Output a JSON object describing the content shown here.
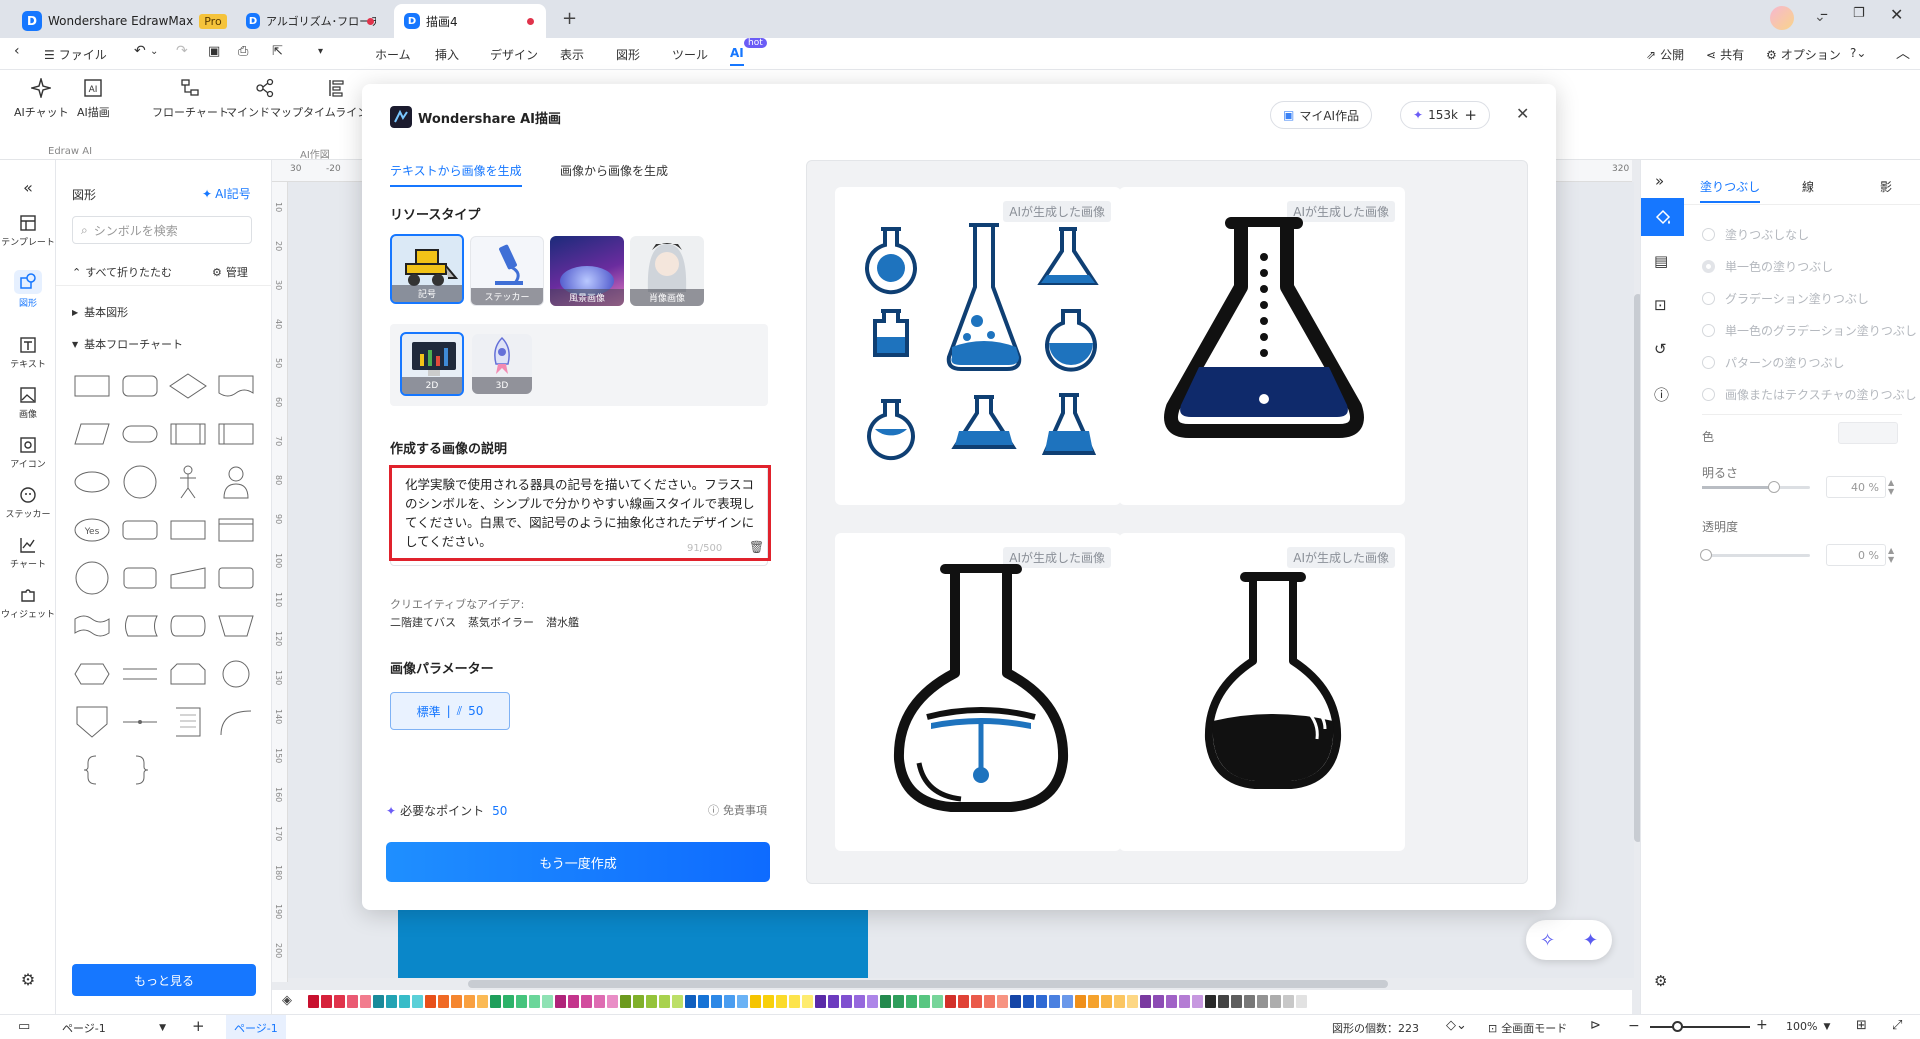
{
  "titlebar": {
    "app_tab": "Wondershare EdrawMax",
    "pro_badge": "Pro",
    "doc_tab_1": "アルゴリズム･フローチ...",
    "doc_tab_2": "描画4",
    "new_tab": "+"
  },
  "menubar": {
    "file": "ファイル",
    "tabs": [
      "ホーム",
      "挿入",
      "デザイン",
      "表示",
      "図形",
      "ツール",
      "AI"
    ],
    "ai_hot": "hot",
    "publish": "公開",
    "share": "共有",
    "options": "オプション"
  },
  "ribbon": {
    "ai_chat": "AIチャット",
    "ai_draw": "AI描画",
    "flowchart": "フローチャート",
    "mindmap": "マインドマップ",
    "timeline": "タイムライン",
    "group1": "Edraw AI",
    "group2": "AI作図"
  },
  "leftrail": {
    "items": [
      "テンプレート",
      "図形",
      "テキスト",
      "画像",
      "アイコン",
      "ステッカー",
      "チャート",
      "ウィジェット"
    ]
  },
  "shapes_panel": {
    "title": "図形",
    "ai_symbol": "AI記号",
    "search_placeholder": "シンボルを検索",
    "collapse_all": "すべて折りたたむ",
    "manage": "管理",
    "section1": "基本図形",
    "section2": "基本フローチャート",
    "yes_label": "Yes",
    "more": "もっと見る"
  },
  "ruler": {
    "top": [
      "30",
      "-20",
      "320"
    ],
    "left": [
      "10",
      "20",
      "30",
      "40",
      "50",
      "60",
      "70",
      "80",
      "90",
      "100",
      "110",
      "120",
      "130",
      "140",
      "150",
      "160",
      "170",
      "180",
      "190",
      "200"
    ]
  },
  "modal": {
    "title": "Wondershare AI描画",
    "my_works": "マイAI作品",
    "credits": "153k",
    "tab_text2img": "テキストから画像を生成",
    "tab_img2img": "画像から画像を生成",
    "resource_type": "リソースタイプ",
    "resource_tiles": [
      "記号",
      "ステッカー",
      "風景画像",
      "肖像画像"
    ],
    "style_tiles": [
      "2D",
      "3D"
    ],
    "desc_heading": "作成する画像の説明",
    "prompt": "化学実験で使用される器具の記号を描いてください。フラスコのシンボルを、シンプルで分かりやすい線画スタイルで表現してください。白黒で、図記号のように抽象化されたデザインにしてください。",
    "char_count": "91/500",
    "ideas_label": "クリエイティブなアイデア:",
    "ideas": [
      "二階建てバス",
      "蒸気ボイラー",
      "潜水艦"
    ],
    "params_heading": "画像パラメーター",
    "param_quality": "標準",
    "param_count": "50",
    "points_label": "必要なポイント",
    "points_value": "50",
    "disclaimer": "免責事項",
    "regenerate": "もう一度作成",
    "ai_tag": "AIが生成した画像"
  },
  "rightpanel": {
    "tabs": [
      "塗りつぶし",
      "線",
      "影"
    ],
    "fill_options": [
      "塗りつぶしなし",
      "単一色の塗りつぶし",
      "グラデーション塗りつぶし",
      "単一色のグラデーション塗りつぶし",
      "パターンの塗りつぶし",
      "画像またはテクスチャの塗りつぶし"
    ],
    "color": "色",
    "brightness": "明るさ",
    "brightness_value": "40 %",
    "transparency": "透明度",
    "transparency_value": "0 %"
  },
  "statusbar": {
    "page_select": "ページ-1",
    "add_page": "+",
    "page_tab": "ページ-1",
    "shape_count_label": "図形の個数：",
    "shape_count": "223",
    "fullscreen": "全画面モード",
    "zoom": "100%"
  },
  "colors": {
    "accent": "#1677ff",
    "highlight_border": "#e0222c",
    "palette": [
      "#c8102e",
      "#d6213a",
      "#e0334b",
      "#ea5a73",
      "#f27c8e",
      "#1a8a9a",
      "#23a3b3",
      "#38bcc8",
      "#5bd0d8",
      "#e8501a",
      "#f06a25",
      "#f5862f",
      "#f9a040",
      "#fbba55",
      "#1f9f5b",
      "#2db36a",
      "#45c47d",
      "#6bd69a",
      "#8fe2b4",
      "#b0247a",
      "#c4358c",
      "#d24c9e",
      "#de6cb2",
      "#e98dc6",
      "#6c9a1e",
      "#80b02a",
      "#94c33a",
      "#a8d24e",
      "#bcdf68",
      "#0f5fbf",
      "#1673d6",
      "#2d88e6",
      "#4a9df0",
      "#6ab2f5",
      "#f5c400",
      "#f8d00a",
      "#fbdb2a",
      "#fde44c",
      "#feec70",
      "#5a2aa8",
      "#6c3bbf",
      "#8050d0",
      "#9668dd",
      "#ad85e8",
      "#248a4e",
      "#2f9e5c",
      "#3fb46c",
      "#58c681",
      "#77d59a",
      "#d2302a",
      "#e04236",
      "#ea5a4a",
      "#f27664",
      "#f79482",
      "#1545a6",
      "#1d56c0",
      "#2f6ad4",
      "#4a80e0",
      "#6a98ea",
      "#f0901a",
      "#f5a22c",
      "#f8b444",
      "#fbc662",
      "#fdd784",
      "#7a3aa0",
      "#8d4cb5",
      "#a062c6",
      "#b47cd4",
      "#c798e0",
      "#2a2a2a",
      "#444",
      "#5e5e5e",
      "#787878",
      "#939393",
      "#adadad",
      "#c8c8c8",
      "#e2e2e2"
    ]
  }
}
